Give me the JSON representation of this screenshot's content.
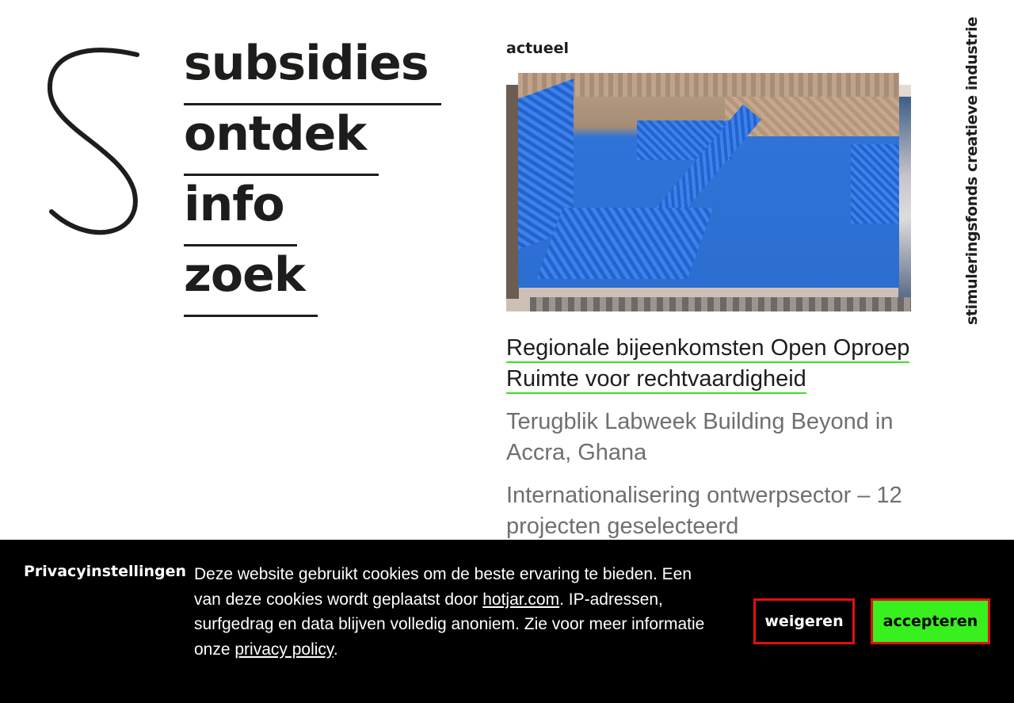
{
  "nav": {
    "items": [
      {
        "label": "subsidies"
      },
      {
        "label": "ontdek"
      },
      {
        "label": "info"
      },
      {
        "label": "zoek"
      }
    ]
  },
  "brand": {
    "logo_icon": "letter-s-logo",
    "tagline": "stimuleringsfonds creatieve industrie"
  },
  "news": {
    "heading": "actueel",
    "articles": [
      {
        "title": "Regionale bijeenkomsten Open Oproep Ruimte voor rechtvaardigheid",
        "featured": true
      },
      {
        "title": "Terugblik Labweek Building Beyond in Accra, Ghana",
        "featured": false
      },
      {
        "title": "Internationalisering ontwerpsector – 12 projecten geselecteerd",
        "featured": false
      }
    ]
  },
  "cookie": {
    "title": "Privacyinstellingen",
    "text_1": "Deze website gebruikt cookies om de beste ervaring te bieden. Een van deze cookies wordt geplaatst door ",
    "link_hotjar": "hotjar.com",
    "text_2": ". IP-adressen, surfgedrag en data blijven volledig anoniem. Zie voor meer informatie onze ",
    "link_privacy": "privacy policy",
    "text_3": ".",
    "decline_label": "weigeren",
    "accept_label": "accepteren"
  },
  "colors": {
    "text": "#1d1d1b",
    "accent_green": "#38f01e",
    "underline_green": "#38e11b",
    "button_border_red": "#e01010",
    "banner_bg": "#000000"
  }
}
